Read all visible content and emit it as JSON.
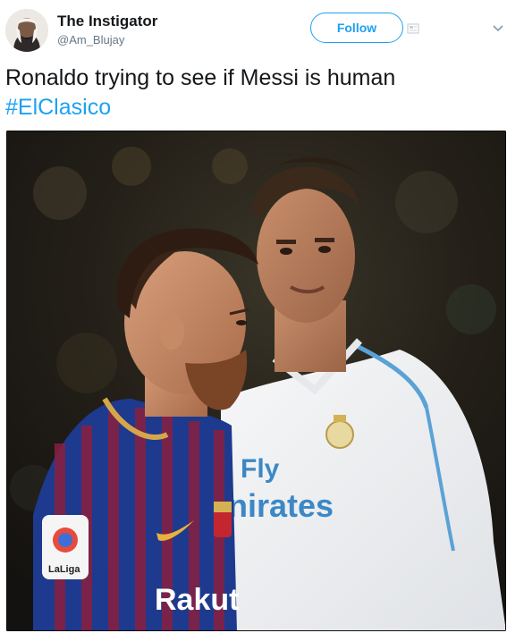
{
  "user": {
    "display_name": "The Instigator",
    "handle": "@Am_Blujay"
  },
  "follow": {
    "label": "Follow"
  },
  "tweet": {
    "text": "Ronaldo trying to see if Messi is human",
    "hashtag": "#ElClasico"
  },
  "media": {
    "icons": [
      "avatar-image",
      "follow-extra-icon",
      "chevron-down-icon"
    ],
    "photo_text": {
      "sponsor_real": "Fly",
      "sponsor_real_2": "nirates",
      "sponsor_barca": "Rakut",
      "league_badge": "LaLiga"
    }
  },
  "colors": {
    "accent": "#1da1f2",
    "text": "#14171a",
    "muted": "#657786"
  }
}
